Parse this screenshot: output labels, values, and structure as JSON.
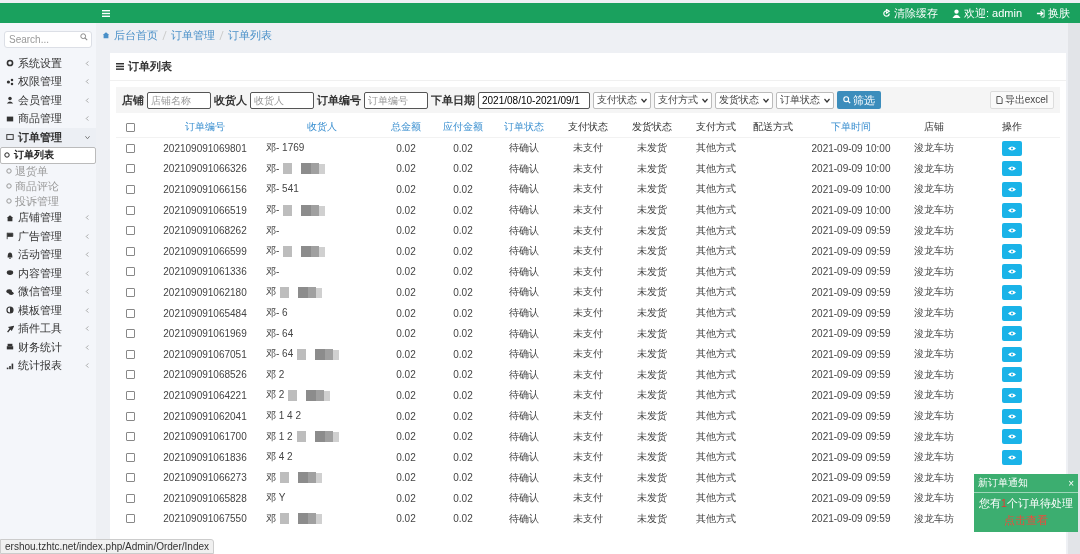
{
  "topbar": {
    "actions": [
      {
        "label": "清除缓存"
      },
      {
        "label": "欢迎: admin"
      },
      {
        "label": "换肤"
      }
    ]
  },
  "sidebar": {
    "search": {
      "placeholder": "Search..."
    },
    "items": [
      {
        "label": "系统设置",
        "expanded": false
      },
      {
        "label": "权限管理",
        "expanded": false
      },
      {
        "label": "会员管理",
        "expanded": false
      },
      {
        "label": "商品管理",
        "expanded": false
      },
      {
        "label": "订单管理",
        "expanded": true,
        "children": [
          {
            "label": "订单列表",
            "selected": true
          },
          {
            "label": "退货单",
            "selected": false
          },
          {
            "label": "商品评论",
            "selected": false
          },
          {
            "label": "投诉管理",
            "selected": false
          }
        ]
      },
      {
        "label": "店铺管理",
        "expanded": false
      },
      {
        "label": "广告管理",
        "expanded": false
      },
      {
        "label": "活动管理",
        "expanded": false
      },
      {
        "label": "内容管理",
        "expanded": false
      },
      {
        "label": "微信管理",
        "expanded": false
      },
      {
        "label": "模板管理",
        "expanded": false
      },
      {
        "label": "插件工具",
        "expanded": false
      },
      {
        "label": "财务统计",
        "expanded": false
      },
      {
        "label": "统计报表",
        "expanded": false
      }
    ]
  },
  "breadcrumb": [
    "后台首页",
    "订单管理",
    "订单列表"
  ],
  "panel": {
    "title": "订单列表",
    "filters": [
      {
        "kind": "input",
        "label": "店铺",
        "placeholder": "店铺名称"
      },
      {
        "kind": "input",
        "label": "收货人",
        "placeholder": "收货人"
      },
      {
        "kind": "input",
        "label": "订单编号",
        "placeholder": "订单编号"
      },
      {
        "kind": "input",
        "label": "下单日期",
        "value": "2021/08/10-2021/09/1"
      },
      {
        "kind": "select",
        "value": "支付状态"
      },
      {
        "kind": "select",
        "value": "支付方式"
      },
      {
        "kind": "select",
        "value": "发货状态"
      },
      {
        "kind": "select",
        "value": "订单状态"
      }
    ],
    "filter_button": "筛选",
    "export_button": "导出excel"
  },
  "table": {
    "select_all": {
      "checked": false
    },
    "columns": [
      {
        "label": "订单编号",
        "sortable": true
      },
      {
        "label": "收货人",
        "sortable": true
      },
      {
        "label": "总金额",
        "sortable": true
      },
      {
        "label": "应付金额",
        "sortable": true
      },
      {
        "label": "订单状态",
        "sortable": true
      },
      {
        "label": "支付状态",
        "sortable": false
      },
      {
        "label": "发货状态",
        "sortable": false
      },
      {
        "label": "支付方式",
        "sortable": false
      },
      {
        "label": "配送方式",
        "sortable": false
      },
      {
        "label": "下单时间",
        "sortable": true
      },
      {
        "label": "店铺",
        "sortable": false
      },
      {
        "label": "操作",
        "sortable": false
      }
    ],
    "rows": [
      {
        "checked": false,
        "masked": false,
        "order_no": "202109091069801",
        "receiver": "邓- 1769",
        "total": "0.02",
        "payable": "0.02",
        "order_status": "待确认",
        "pay_status": "未支付",
        "ship_status": "未发货",
        "pay_method": "其他方式",
        "time": "2021-09-09 10:00",
        "store": "浚龙车坊"
      },
      {
        "checked": false,
        "masked": true,
        "order_no": "202109091066326",
        "receiver": "邓-",
        "total": "0.02",
        "payable": "0.02",
        "order_status": "待确认",
        "pay_status": "未支付",
        "ship_status": "未发货",
        "pay_method": "其他方式",
        "time": "2021-09-09 10:00",
        "store": "浚龙车坊"
      },
      {
        "checked": false,
        "masked": false,
        "order_no": "202109091066156",
        "receiver": "邓- 541",
        "total": "0.02",
        "payable": "0.02",
        "order_status": "待确认",
        "pay_status": "未支付",
        "ship_status": "未发货",
        "pay_method": "其他方式",
        "time": "2021-09-09 10:00",
        "store": "浚龙车坊"
      },
      {
        "checked": false,
        "masked": true,
        "order_no": "202109091066519",
        "receiver": "邓-",
        "total": "0.02",
        "payable": "0.02",
        "order_status": "待确认",
        "pay_status": "未支付",
        "ship_status": "未发货",
        "pay_method": "其他方式",
        "time": "2021-09-09 10:00",
        "store": "浚龙车坊"
      },
      {
        "checked": false,
        "masked": false,
        "order_no": "202109091068262",
        "receiver": "邓-",
        "total": "0.02",
        "payable": "0.02",
        "order_status": "待确认",
        "pay_status": "未支付",
        "ship_status": "未发货",
        "pay_method": "其他方式",
        "time": "2021-09-09 09:59",
        "store": "浚龙车坊"
      },
      {
        "checked": false,
        "masked": true,
        "order_no": "202109091066599",
        "receiver": "邓-",
        "total": "0.02",
        "payable": "0.02",
        "order_status": "待确认",
        "pay_status": "未支付",
        "ship_status": "未发货",
        "pay_method": "其他方式",
        "time": "2021-09-09 09:59",
        "store": "浚龙车坊"
      },
      {
        "checked": false,
        "masked": false,
        "order_no": "202109091061336",
        "receiver": "邓-",
        "total": "0.02",
        "payable": "0.02",
        "order_status": "待确认",
        "pay_status": "未支付",
        "ship_status": "未发货",
        "pay_method": "其他方式",
        "time": "2021-09-09 09:59",
        "store": "浚龙车坊"
      },
      {
        "checked": false,
        "masked": true,
        "order_no": "202109091062180",
        "receiver": "邓",
        "total": "0.02",
        "payable": "0.02",
        "order_status": "待确认",
        "pay_status": "未支付",
        "ship_status": "未发货",
        "pay_method": "其他方式",
        "time": "2021-09-09 09:59",
        "store": "浚龙车坊"
      },
      {
        "checked": false,
        "masked": false,
        "order_no": "202109091065484",
        "receiver": "邓- 6",
        "total": "0.02",
        "payable": "0.02",
        "order_status": "待确认",
        "pay_status": "未支付",
        "ship_status": "未发货",
        "pay_method": "其他方式",
        "time": "2021-09-09 09:59",
        "store": "浚龙车坊"
      },
      {
        "checked": false,
        "masked": false,
        "order_no": "202109091061969",
        "receiver": "邓- 64",
        "total": "0.02",
        "payable": "0.02",
        "order_status": "待确认",
        "pay_status": "未支付",
        "ship_status": "未发货",
        "pay_method": "其他方式",
        "time": "2021-09-09 09:59",
        "store": "浚龙车坊"
      },
      {
        "checked": false,
        "masked": true,
        "order_no": "202109091067051",
        "receiver": "邓- 64",
        "total": "0.02",
        "payable": "0.02",
        "order_status": "待确认",
        "pay_status": "未支付",
        "ship_status": "未发货",
        "pay_method": "其他方式",
        "time": "2021-09-09 09:59",
        "store": "浚龙车坊"
      },
      {
        "checked": false,
        "masked": false,
        "order_no": "202109091068526",
        "receiver": "邓 2",
        "total": "0.02",
        "payable": "0.02",
        "order_status": "待确认",
        "pay_status": "未支付",
        "ship_status": "未发货",
        "pay_method": "其他方式",
        "time": "2021-09-09 09:59",
        "store": "浚龙车坊"
      },
      {
        "checked": false,
        "masked": true,
        "order_no": "202109091064221",
        "receiver": "邓 2",
        "total": "0.02",
        "payable": "0.02",
        "order_status": "待确认",
        "pay_status": "未支付",
        "ship_status": "未发货",
        "pay_method": "其他方式",
        "time": "2021-09-09 09:59",
        "store": "浚龙车坊"
      },
      {
        "checked": false,
        "masked": false,
        "order_no": "202109091062041",
        "receiver": "邓 1 4 2",
        "total": "0.02",
        "payable": "0.02",
        "order_status": "待确认",
        "pay_status": "未支付",
        "ship_status": "未发货",
        "pay_method": "其他方式",
        "time": "2021-09-09 09:59",
        "store": "浚龙车坊"
      },
      {
        "checked": false,
        "masked": true,
        "order_no": "202109091061700",
        "receiver": "邓 1 2",
        "total": "0.02",
        "payable": "0.02",
        "order_status": "待确认",
        "pay_status": "未支付",
        "ship_status": "未发货",
        "pay_method": "其他方式",
        "time": "2021-09-09 09:59",
        "store": "浚龙车坊"
      },
      {
        "checked": false,
        "masked": false,
        "order_no": "202109091061836",
        "receiver": "邓 4 2",
        "total": "0.02",
        "payable": "0.02",
        "order_status": "待确认",
        "pay_status": "未支付",
        "ship_status": "未发货",
        "pay_method": "其他方式",
        "time": "2021-09-09 09:59",
        "store": "浚龙车坊"
      },
      {
        "checked": false,
        "masked": true,
        "order_no": "202109091066273",
        "receiver": "邓",
        "total": "0.02",
        "payable": "0.02",
        "order_status": "待确认",
        "pay_status": "未支付",
        "ship_status": "未发货",
        "pay_method": "其他方式",
        "time": "2021-09-09 09:59",
        "store": "浚龙车坊"
      },
      {
        "checked": false,
        "masked": false,
        "order_no": "202109091065828",
        "receiver": "邓 Y",
        "total": "0.02",
        "payable": "0.02",
        "order_status": "待确认",
        "pay_status": "未支付",
        "ship_status": "未发货",
        "pay_method": "其他方式",
        "time": "2021-09-09 09:59",
        "store": "浚龙车坊"
      },
      {
        "checked": false,
        "masked": true,
        "order_no": "202109091067550",
        "receiver": "邓",
        "total": "0.02",
        "payable": "0.02",
        "order_status": "待确认",
        "pay_status": "未支付",
        "ship_status": "未发货",
        "pay_method": "其他方式",
        "time": "2021-09-09 09:59",
        "store": "浚龙车坊"
      }
    ]
  },
  "notification": {
    "title": "新订单通知",
    "close": "×",
    "prefix": "您有",
    "count": "1",
    "suffix": "个订单待处理",
    "link": "点击查看"
  },
  "status_url": "ershou.tzhtc.net/index.php/Admin/Order/Index"
}
